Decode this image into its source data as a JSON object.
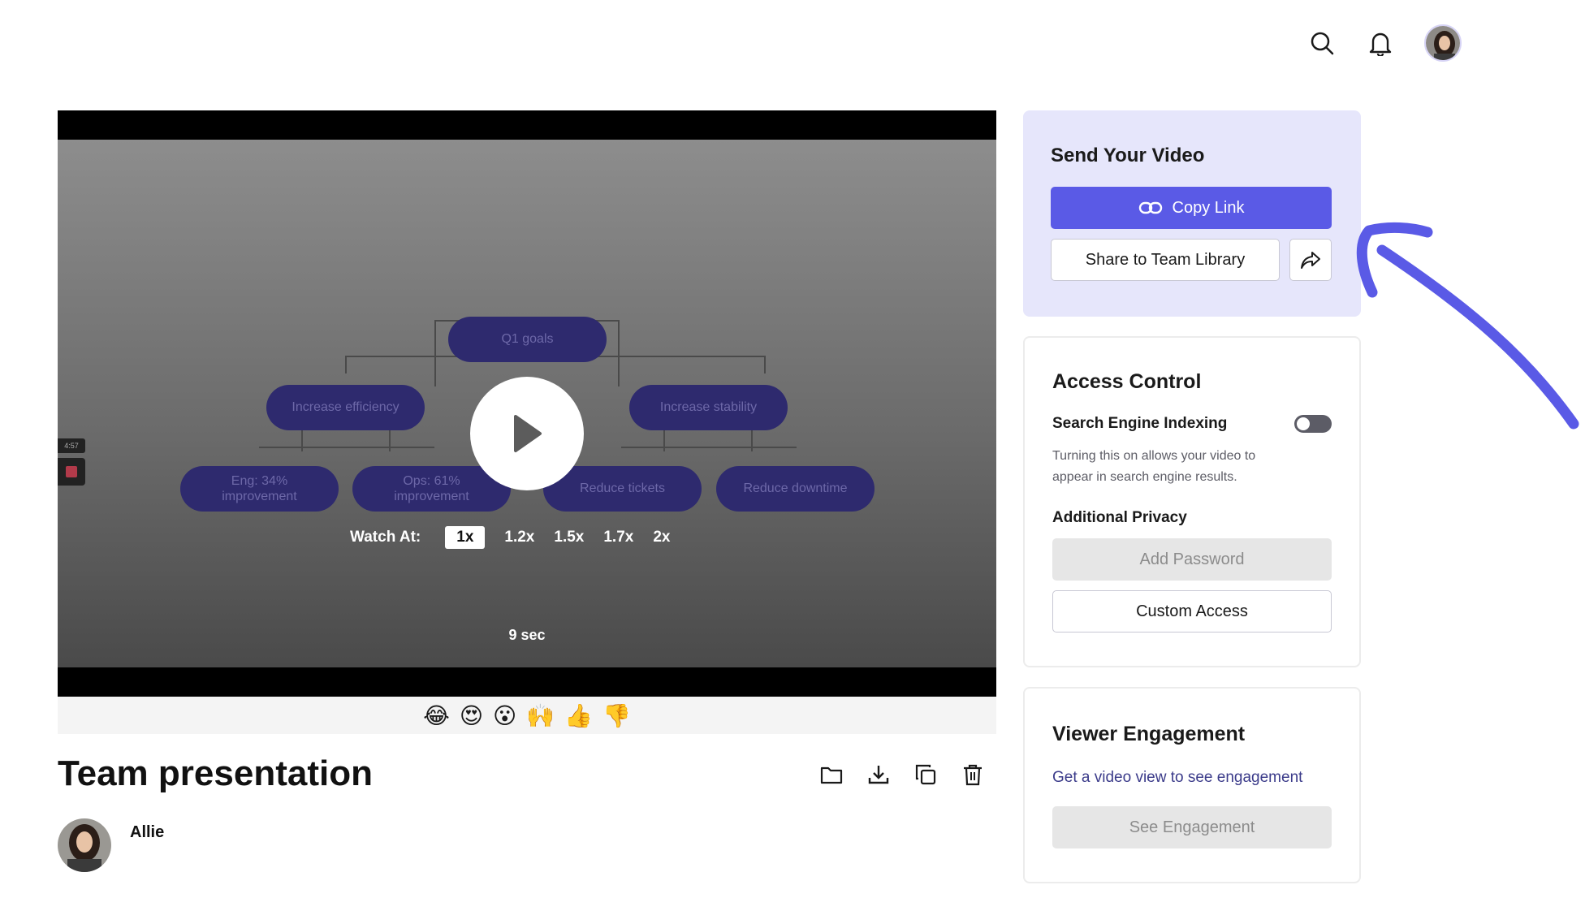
{
  "header": {
    "search_icon": "search-icon",
    "bell_icon": "bell-icon"
  },
  "video": {
    "recording_time": "4:57",
    "diagram": {
      "root": "Q1 goals",
      "left_branch": "Increase efficiency",
      "right_branch": "Increase stability",
      "leaves": [
        "Eng: 34% improvement",
        "Ops: 61% improvement",
        "Reduce tickets",
        "Reduce downtime"
      ]
    },
    "watch_at_label": "Watch At:",
    "speeds": [
      "1x",
      "1.2x",
      "1.5x",
      "1.7x",
      "2x"
    ],
    "active_speed": "1x",
    "duration": "9 sec"
  },
  "reactions": [
    "😂",
    "😍",
    "😮",
    "🙌",
    "👍",
    "👎"
  ],
  "title": "Team presentation",
  "author": {
    "name": "Allie"
  },
  "send_panel": {
    "heading": "Send Your Video",
    "copy_link": "Copy Link",
    "share_team_library": "Share to Team Library"
  },
  "access_control": {
    "heading": "Access Control",
    "search_indexing_label": "Search Engine Indexing",
    "search_indexing_enabled": false,
    "help_text": "Turning this on allows your video to appear in search engine results.",
    "additional_privacy": "Additional Privacy",
    "add_password": "Add Password",
    "custom_access": "Custom Access"
  },
  "viewer_engagement": {
    "heading": "Viewer Engagement",
    "description": "Get a video view to see engagement",
    "see_engagement": "See Engagement"
  },
  "colors": {
    "accent": "#5a5ae6",
    "send_panel_bg": "#e6e6fb",
    "node_bg": "#2e2a6e"
  }
}
